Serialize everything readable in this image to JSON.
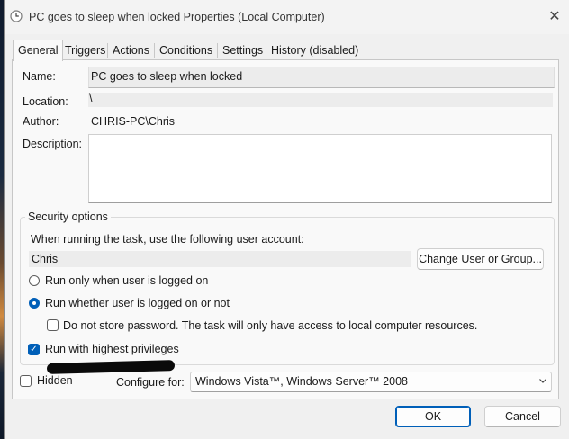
{
  "window": {
    "title": "PC goes to sleep when locked Properties (Local Computer)",
    "close_glyph": "✕"
  },
  "tabs": [
    {
      "label": "General"
    },
    {
      "label": "Triggers"
    },
    {
      "label": "Actions"
    },
    {
      "label": "Conditions"
    },
    {
      "label": "Settings"
    },
    {
      "label": "History (disabled)"
    }
  ],
  "general": {
    "name_label": "Name:",
    "name_value": "PC goes to sleep when locked",
    "location_label": "Location:",
    "location_value": "\\",
    "author_label": "Author:",
    "author_value": "CHRIS-PC\\Chris",
    "description_label": "Description:",
    "description_value": ""
  },
  "security": {
    "title": "Security options",
    "account_prompt": "When running the task, use the following user account:",
    "account_value": "Chris",
    "change_button": "Change User or Group...",
    "radio_logged_on": "Run only when user is logged on",
    "radio_whether": "Run whether user is logged on or not",
    "selected_radio": "whether",
    "do_not_store_label": "Do not store password.  The task will only have access to local computer resources.",
    "do_not_store_checked": false,
    "highest_privileges_label": "Run with highest privileges",
    "highest_privileges_checked": true
  },
  "bottom": {
    "hidden_label": "Hidden",
    "hidden_checked": false,
    "configure_label": "Configure for:",
    "configure_value": "Windows Vista™, Windows Server™ 2008"
  },
  "buttons": {
    "ok": "OK",
    "cancel": "Cancel"
  },
  "colors": {
    "accent": "#005fb8",
    "panel": "#f9f9f9",
    "window": "#f0f0f0"
  }
}
